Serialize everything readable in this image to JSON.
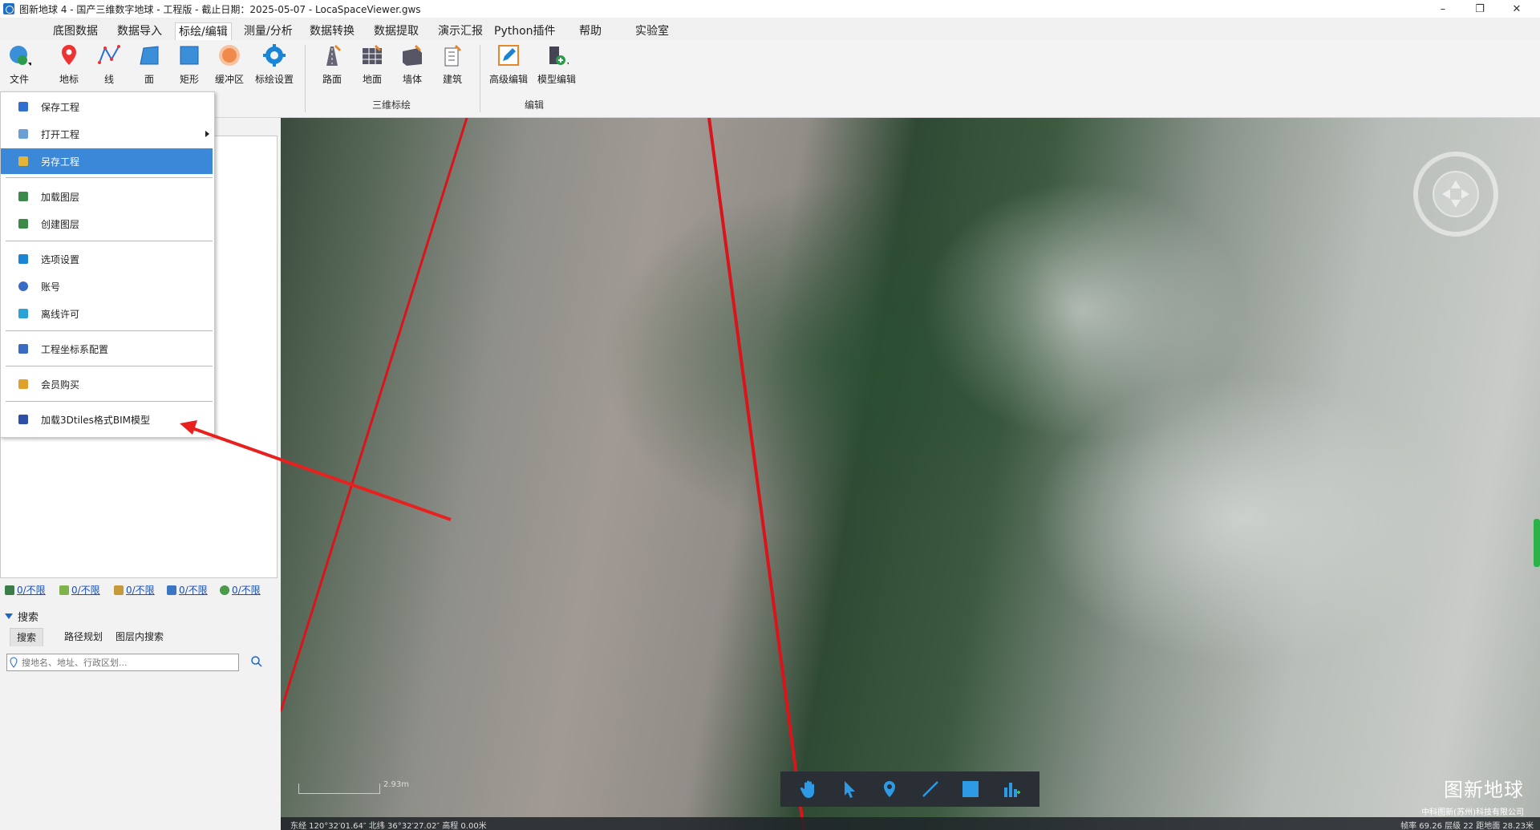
{
  "window": {
    "title": "图新地球 4 - 国产三维数字地球 - 工程版 - 截止日期：2025-05-07 - LocaSpaceViewer.gws",
    "minimize": "–",
    "maximize": "❐",
    "close": "✕"
  },
  "menu": {
    "items": [
      "底图数据",
      "数据导入",
      "标绘/编辑",
      "测量/分析",
      "数据转换",
      "数据提取",
      "演示汇报",
      "Python插件",
      "帮助",
      "实验室"
    ],
    "active": "标绘/编辑"
  },
  "ribbon": {
    "file_label": "文件",
    "buttons": [
      "地标",
      "线",
      "面",
      "矩形",
      "缓冲区",
      "标绘设置"
    ],
    "group3d": [
      "路面",
      "地面",
      "墙体",
      "建筑"
    ],
    "group_edit": [
      "高级编辑",
      "模型编辑"
    ],
    "group_labels": {
      "three_d": "三维标绘",
      "edit": "编辑"
    }
  },
  "file_menu": {
    "items": [
      {
        "label": "保存工程",
        "icon": "save-icon",
        "color": "#2f6fd0"
      },
      {
        "label": "打开工程",
        "icon": "open-project-icon",
        "color": "#6b9fd6",
        "submenu": true
      },
      {
        "label": "另存工程",
        "icon": "save-as-icon",
        "color": "#e5b53a",
        "selected": true
      },
      {
        "label": "加载图层",
        "icon": "load-layer-icon",
        "color": "#3c8a4a"
      },
      {
        "label": "创建图层",
        "icon": "create-layer-icon",
        "color": "#3c8a4a"
      },
      {
        "label": "选项设置",
        "icon": "settings-icon",
        "color": "#1a84d6"
      },
      {
        "label": "账号",
        "icon": "account-icon",
        "color": "#3a6bc4"
      },
      {
        "label": "离线许可",
        "icon": "license-icon",
        "color": "#2aa3d8"
      },
      {
        "label": "工程坐标系配置",
        "icon": "coordinate-icon",
        "color": "#3a6bc4"
      },
      {
        "label": "会员购买",
        "icon": "crown-icon",
        "color": "#e0a12a"
      },
      {
        "label": "加载3Dtiles格式BIM模型",
        "icon": "bim-model-icon",
        "color": "#2d4fa8"
      }
    ]
  },
  "left_panel": {
    "stats": [
      "0/不限",
      "0/不限",
      "0/不限",
      "0/不限",
      "0/不限"
    ],
    "search_title": "搜索",
    "search_tabs": [
      "搜索",
      "路径规划",
      "图层内搜索"
    ],
    "search_placeholder": "搜地名、地址、行政区划..."
  },
  "map": {
    "brand_name": "图新地球",
    "brand_company": "中科图新(苏州)科技有限公司",
    "scale_text": "2.93m",
    "status_left": "东经 120°32′01.64″ 北纬 36°32′27.02″ 高程 0.00米",
    "status_right": "帧率 69.26  层级 22  距地面 28.23米",
    "toolbar": [
      "pan-hand-icon",
      "select-pointer-icon",
      "placemark-icon",
      "line-draw-icon",
      "rectangle-icon",
      "chart-icon"
    ]
  },
  "colors": {
    "accent": "#3b87d8",
    "annotation_arrow": "#e8201e",
    "map_line": "#d9141a"
  }
}
